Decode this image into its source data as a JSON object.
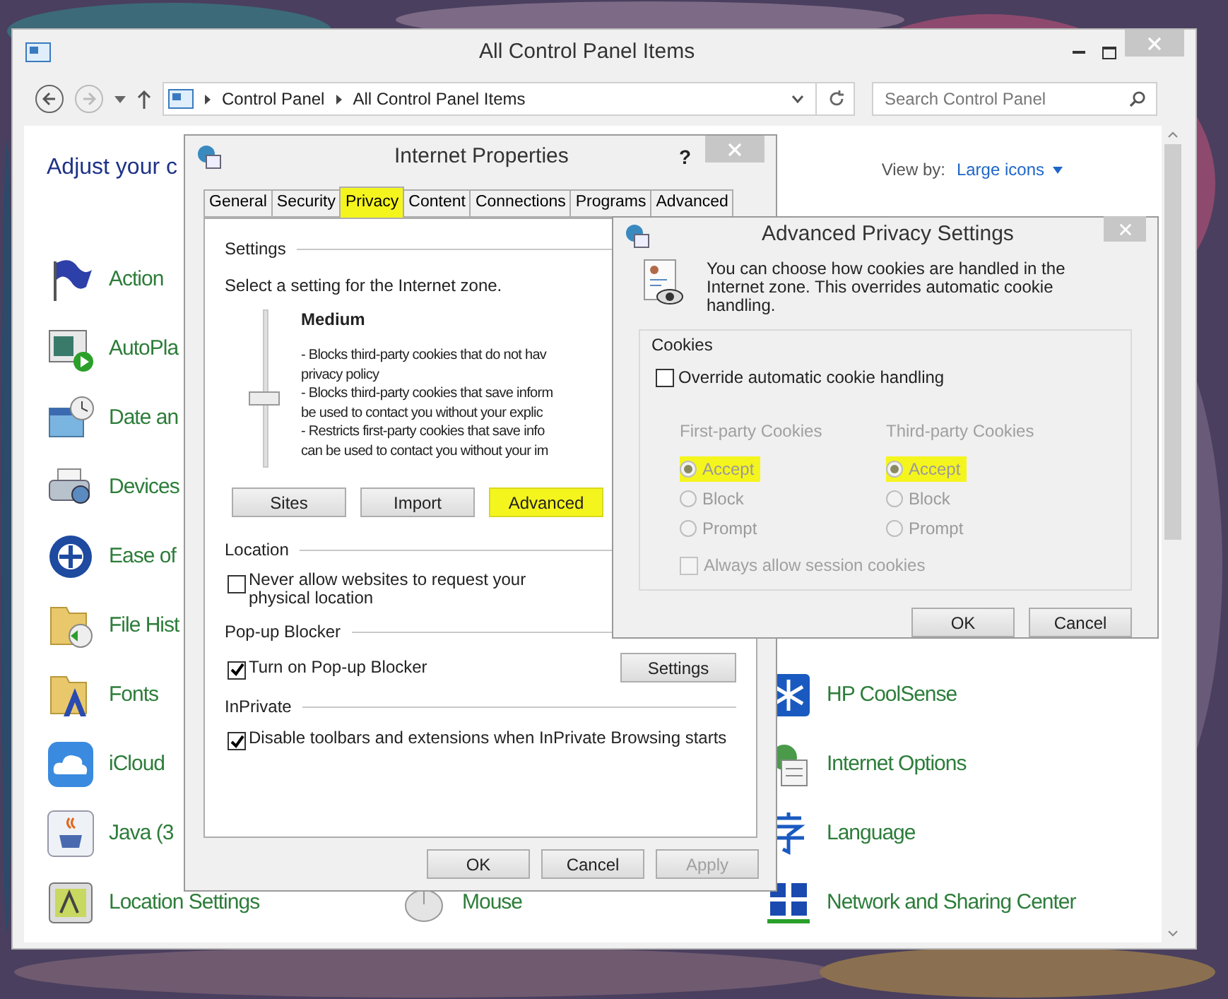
{
  "main_window": {
    "title": "All Control Panel Items",
    "breadcrumb": [
      "Control Panel",
      "All Control Panel Items"
    ],
    "search_placeholder": "Search Control Panel",
    "heading": "Adjust your c",
    "view_by_label": "View by:",
    "view_by_value": "Large icons",
    "columns": [
      [
        {
          "label": "Action"
        },
        {
          "label": "AutoPla"
        },
        {
          "label": "Date an"
        },
        {
          "label": "Devices"
        },
        {
          "label": "Ease of"
        },
        {
          "label": "File Hist"
        },
        {
          "label": "Fonts"
        },
        {
          "label": "iCloud"
        },
        {
          "label": "Java (3"
        },
        {
          "label": "Location Settings"
        }
      ],
      [
        {
          "label": "Mouse"
        }
      ],
      [
        {
          "label": "HP CoolSense"
        },
        {
          "label": "Internet Options"
        },
        {
          "label": "Language"
        },
        {
          "label": "Network and Sharing Center"
        }
      ]
    ]
  },
  "internet_properties": {
    "title": "Internet Properties",
    "help": "?",
    "tabs": [
      {
        "label": "General",
        "selected": false,
        "highlighted": false
      },
      {
        "label": "Security",
        "selected": false,
        "highlighted": false
      },
      {
        "label": "Privacy",
        "selected": true,
        "highlighted": true
      },
      {
        "label": "Content",
        "selected": false,
        "highlighted": false
      },
      {
        "label": "Connections",
        "selected": false,
        "highlighted": false
      },
      {
        "label": "Programs",
        "selected": false,
        "highlighted": false
      },
      {
        "label": "Advanced",
        "selected": false,
        "highlighted": false
      }
    ],
    "settings_label": "Settings",
    "zone_text": "Select a setting for the Internet zone.",
    "slider": {
      "level": 0.4
    },
    "level_name": "Medium",
    "description": [
      "- Blocks third-party cookies that do not hav",
      "privacy policy",
      "- Blocks third-party cookies that save inform",
      "be used to contact you without your explic",
      "- Restricts first-party cookies that save info",
      "can be used to contact you without your im"
    ],
    "buttons": [
      {
        "label": "Sites",
        "highlighted": false
      },
      {
        "label": "Import",
        "highlighted": false
      },
      {
        "label": "Advanced",
        "highlighted": true
      }
    ],
    "groups": [
      {
        "title": "Location",
        "options": [
          {
            "label": "Never allow websites to request your physical location",
            "checked": false
          }
        ]
      },
      {
        "title": "Pop-up Blocker",
        "options": [
          {
            "label": "Turn on Pop-up Blocker",
            "checked": true
          }
        ],
        "button": "Settings"
      },
      {
        "title": "InPrivate",
        "options": [
          {
            "label": "Disable toolbars and extensions when InPrivate Browsing starts",
            "checked": true
          }
        ]
      }
    ],
    "footer": [
      {
        "label": "OK",
        "disabled": false
      },
      {
        "label": "Cancel",
        "disabled": false
      },
      {
        "label": "Apply",
        "disabled": true
      }
    ]
  },
  "advanced_privacy": {
    "title": "Advanced Privacy Settings",
    "intro": "You can choose how cookies are handled in the Internet zone.  This overrides automatic cookie handling.",
    "group": "Cookies",
    "override": {
      "label": "Override automatic cookie handling",
      "checked": false
    },
    "disabled": true,
    "cookie_columns": [
      {
        "title": "First-party Cookies",
        "options": [
          {
            "label": "Accept",
            "selected": true,
            "highlighted": true
          },
          {
            "label": "Block",
            "selected": false,
            "highlighted": false
          },
          {
            "label": "Prompt",
            "selected": false,
            "highlighted": false
          }
        ]
      },
      {
        "title": "Third-party Cookies",
        "options": [
          {
            "label": "Accept",
            "selected": true,
            "highlighted": true
          },
          {
            "label": "Block",
            "selected": false,
            "highlighted": false
          },
          {
            "label": "Prompt",
            "selected": false,
            "highlighted": false
          }
        ]
      }
    ],
    "session": {
      "label": "Always allow session cookies",
      "checked": false
    },
    "footer": [
      "OK",
      "Cancel"
    ]
  }
}
